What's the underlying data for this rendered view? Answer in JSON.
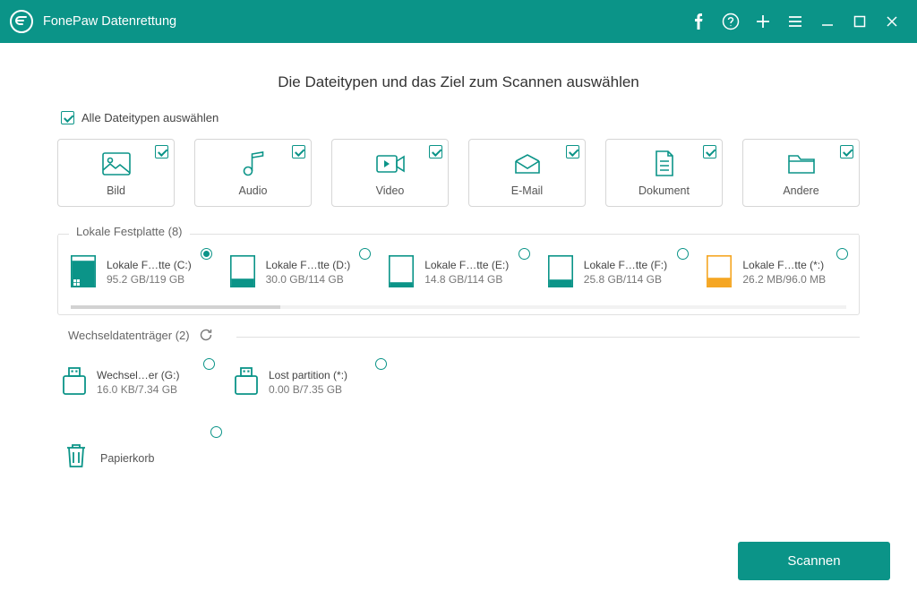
{
  "titlebar": {
    "app_name": "FonePaw Datenrettung"
  },
  "heading": "Die Dateitypen und das Ziel zum Scannen auswählen",
  "select_all_label": "Alle Dateitypen auswählen",
  "types": {
    "image": "Bild",
    "audio": "Audio",
    "video": "Video",
    "email": "E-Mail",
    "document": "Dokument",
    "other": "Andere"
  },
  "sections": {
    "local": {
      "title": "Lokale Festplatte (8)",
      "drives": [
        {
          "name": "Lokale F…tte (C:)",
          "size": "95.2 GB/119 GB",
          "selected": true,
          "fill": 0.8,
          "color": "#0b9488",
          "primary": true
        },
        {
          "name": "Lokale F…tte (D:)",
          "size": "30.0 GB/114 GB",
          "selected": false,
          "fill": 0.26,
          "color": "#0b9488"
        },
        {
          "name": "Lokale F…tte (E:)",
          "size": "14.8 GB/114 GB",
          "selected": false,
          "fill": 0.13,
          "color": "#0b9488"
        },
        {
          "name": "Lokale F…tte (F:)",
          "size": "25.8 GB/114 GB",
          "selected": false,
          "fill": 0.23,
          "color": "#0b9488"
        },
        {
          "name": "Lokale F…tte (*:)",
          "size": "26.2 MB/96.0 MB",
          "selected": false,
          "fill": 0.27,
          "color": "#f5a623"
        }
      ]
    },
    "removable": {
      "title": "Wechseldatenträger (2)",
      "drives": [
        {
          "name": "Wechsel…er (G:)",
          "size": "16.0 KB/7.34 GB"
        },
        {
          "name": "Lost partition (*:)",
          "size": "0.00  B/7.35 GB"
        }
      ]
    },
    "trash": {
      "label": "Papierkorb"
    }
  },
  "scan_button": "Scannen"
}
